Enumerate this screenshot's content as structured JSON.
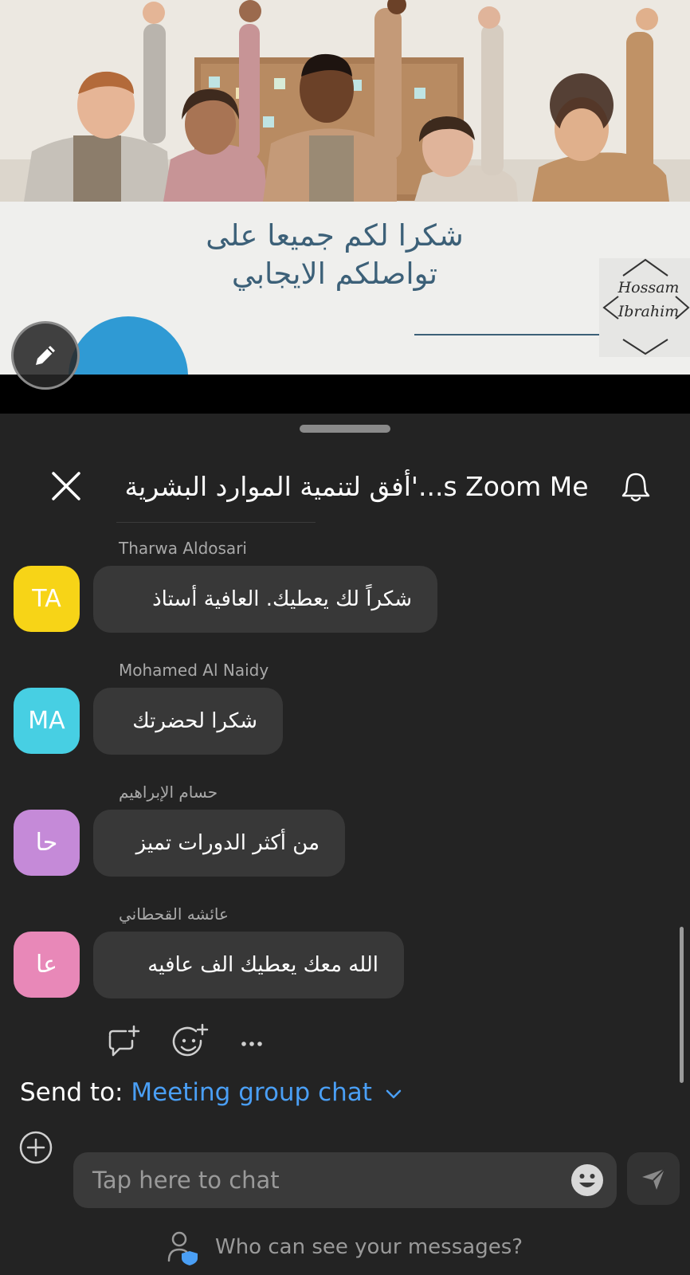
{
  "slide": {
    "title_line1": "شكرا لكم جميعا على",
    "title_line2": "تواصلكم  الايجابي",
    "signature_line1": "Hossam",
    "signature_line2": "Ibrahim"
  },
  "header": {
    "title": "s Zoom Me...'أفق لتنمية الموارد البشرية"
  },
  "messages": [
    {
      "sender": "Tharwa Aldosari",
      "initials": "TA",
      "avatar_color": "#f7d417",
      "text": "شكراً لك يعطيك. العافية أستاذ"
    },
    {
      "sender": "Mohamed Al Naidy",
      "initials": "MA",
      "avatar_color": "#47cfe3",
      "text": "شكرا لحضرتك"
    },
    {
      "sender": "حسام الإبراهيم",
      "initials": "حا",
      "avatar_color": "#c58ad8",
      "text": "من أكثر الدورات تميز"
    },
    {
      "sender": "عائشه القحطاني",
      "initials": "عا",
      "avatar_color": "#e888b8",
      "text": "الله معك يعطيك الف عافيه"
    }
  ],
  "reactions": [
    "reply-icon",
    "add-emoji-icon",
    "more-icon"
  ],
  "send_to": {
    "label": "Send to:",
    "value": "Meeting group chat"
  },
  "composer": {
    "placeholder": "Tap here to chat"
  },
  "privacy": {
    "text": "Who can see your messages?"
  },
  "colors": {
    "accent": "#4a9ff5",
    "panel_bg": "#232323",
    "bubble_bg": "#383838"
  }
}
